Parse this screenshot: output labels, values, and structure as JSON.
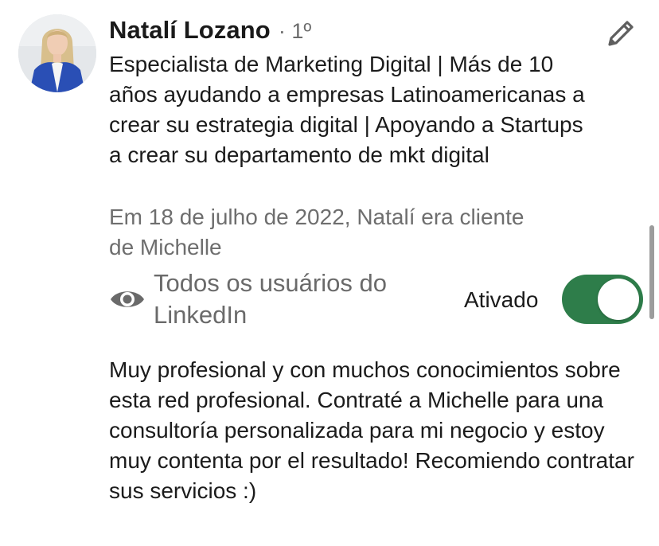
{
  "profile": {
    "name": "Natalí Lozano",
    "degree": "· 1º",
    "headline": "Especialista de Marketing Digital | Más de 10 años ayudando a empresas Latinoamericanas a crear su estrategia digital | Apoyando a Startups a crear su departamento de mkt digital",
    "relation": "Em 18 de julho de 2022, Natalí era cliente de Michelle"
  },
  "icons": {
    "edit": "pencil-icon",
    "visibility": "eye-icon"
  },
  "visibility": {
    "label": "Todos os usuários do LinkedIn"
  },
  "toggle": {
    "label": "Ativado",
    "state": "on",
    "on_color": "#2e7d4a"
  },
  "recommendation": {
    "text": "Muy profesional y con muchos conocimientos sobre esta red profesional. Contraté a Michelle para una consultoría personalizada para mi negocio y estoy muy contenta por el resultado! Recomiendo contratar sus servicios :)"
  }
}
